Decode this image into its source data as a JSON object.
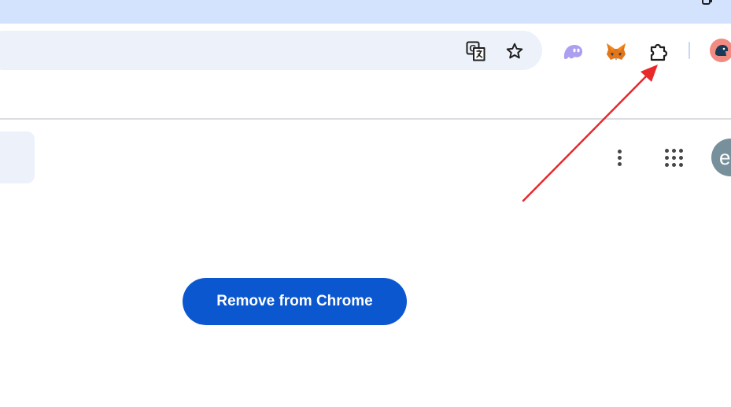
{
  "browser": {
    "omnibox": {
      "translate_icon": "google-translate-icon",
      "bookmark_icon": "star-icon"
    },
    "extensions": [
      {
        "icon": "phantom-ghost-icon",
        "color": "#ab9ff2"
      },
      {
        "icon": "metamask-fox-icon",
        "color": "#e2761b"
      },
      {
        "icon": "puzzle-piece-icon",
        "color": "#1f1f1f"
      }
    ],
    "profile_avatar_icon": "profile-avatar-icon"
  },
  "page": {
    "menu_icon": "more-vert-icon",
    "apps_icon": "apps-grid-icon",
    "account_initial": "e",
    "remove_button_label": "Remove from Chrome"
  },
  "annotation": {
    "arrow_color": "#e8282b"
  },
  "colors": {
    "tabstrip": "#d3e3fd",
    "omnibox": "#edf2fa",
    "primary_button": "#0b57d0",
    "account_avatar": "#78909c"
  }
}
